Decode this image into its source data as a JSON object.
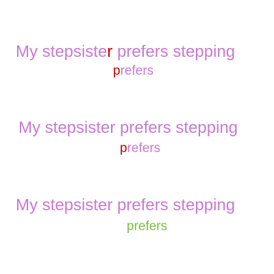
{
  "colors": {
    "base": "#c77bd0",
    "error": "#c40000",
    "correct": "#7ac043"
  },
  "items": [
    {
      "sentence_before": "My stepsiste",
      "sentence_highlight": "r",
      "sentence_after": " prefers stepping",
      "word_highlight": "p",
      "word_rest": "refers"
    },
    {
      "sentence": "My stepsister prefers stepping",
      "word_highlight": "p",
      "word_rest": "refers"
    },
    {
      "sentence": "My stepsister prefers stepping",
      "word": "prefers"
    }
  ]
}
